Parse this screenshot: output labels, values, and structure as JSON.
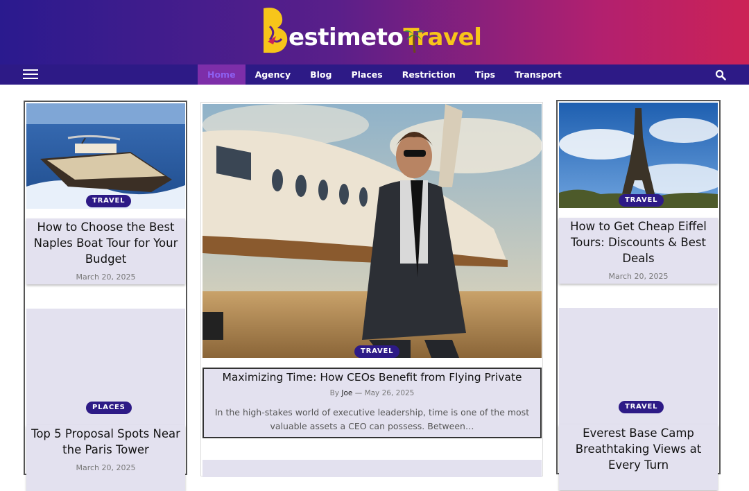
{
  "site": {
    "logo_prefix": "estimeto",
    "logo_suffix": "Travel"
  },
  "nav": {
    "items": [
      "Home",
      "Agency",
      "Blog",
      "Places",
      "Restriction",
      "Tips",
      "Transport"
    ],
    "active": "Home"
  },
  "icons": {
    "menu": "hamburger-menu-icon",
    "search": "search-icon",
    "logo_mark": "b-plane-logo-icon",
    "palm": "palm-tree-icon"
  },
  "colors": {
    "nav_bg": "#2d1a86",
    "badge_bg": "#2d1a86",
    "card_title_bg": "#e3e1ef",
    "logo_yellow": "#f7c51a"
  },
  "posts": {
    "left_1": {
      "category": "TRAVEL",
      "title": "How to Choose the Best Naples Boat Tour for Your Budget",
      "date": "March 20, 2025"
    },
    "left_2": {
      "category": "PLACES",
      "title": "Top 5 Proposal Spots Near the Paris Tower",
      "date": "March 20, 2025"
    },
    "featured": {
      "category": "TRAVEL",
      "title": "Maximizing Time: How CEOs Benefit from Flying Private",
      "by": "By",
      "author": "Joe",
      "sep": "—",
      "date": "May 26, 2025",
      "excerpt": "In the high-stakes world of executive leadership, time is one of the most valuable assets a CEO can possess. Between…"
    },
    "right_1": {
      "category": "TRAVEL",
      "title": "How to Get Cheap Eiffel Tours: Discounts & Best Deals",
      "date": "March 20, 2025"
    },
    "right_2": {
      "category": "TRAVEL",
      "title": "Everest Base Camp Breathtaking Views at Every Turn"
    }
  }
}
